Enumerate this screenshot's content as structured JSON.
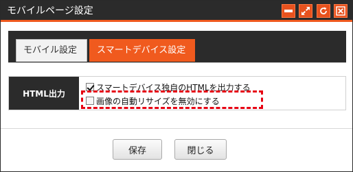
{
  "window": {
    "title": "モバイルページ設定",
    "controls": {
      "minimize": "minimize-icon",
      "maximize": "expand-icon",
      "refresh": "refresh-icon",
      "close": "close-icon"
    }
  },
  "tabs": [
    {
      "label": "モバイル設定",
      "active": false
    },
    {
      "label": "スマートデバイス設定",
      "active": true
    }
  ],
  "setting": {
    "label": "HTML出力",
    "options": [
      {
        "label": "スマートデバイス独自のHTMLを出力する",
        "checked": true
      },
      {
        "label": "画像の自動リサイズを無効にする",
        "checked": false
      }
    ]
  },
  "buttons": {
    "save": "保存",
    "close": "閉じる"
  },
  "colors": {
    "accent": "#f05a1e",
    "dark": "#2b2b2b",
    "highlight": "#e60012"
  }
}
